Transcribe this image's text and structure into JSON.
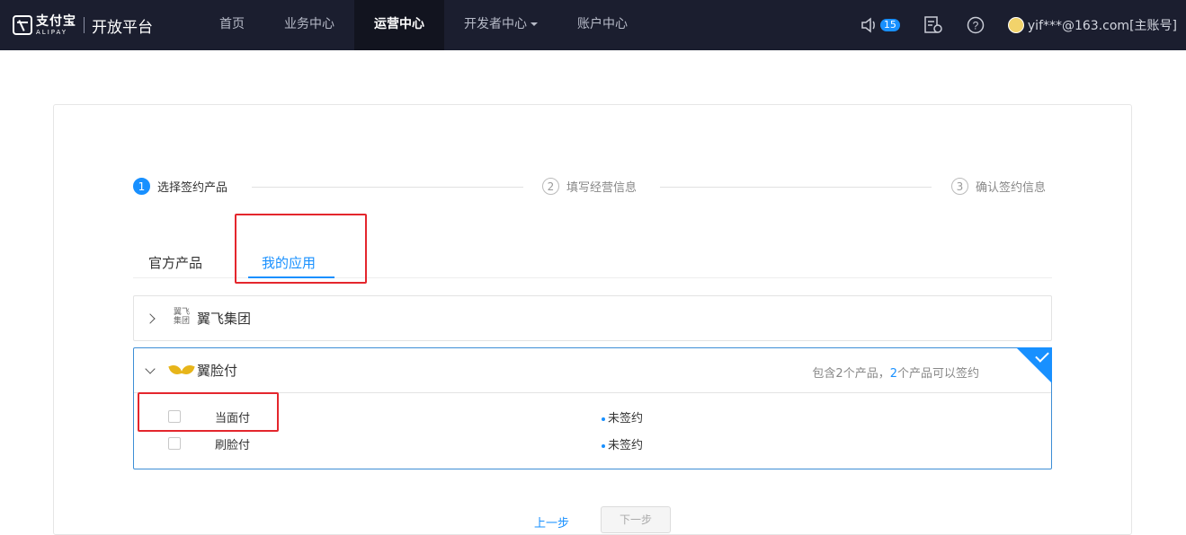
{
  "topbar": {
    "logo_cn": "支付宝",
    "logo_en": "ALIPAY",
    "platform": "开放平台",
    "nav": [
      "首页",
      "业务中心",
      "运营中心",
      "开发者中心",
      "账户中心"
    ],
    "active_nav": "运营中心",
    "notification_count": "15",
    "user": "yif***@163.com[主账号]"
  },
  "steps": [
    {
      "num": "1",
      "label": "选择签约产品"
    },
    {
      "num": "2",
      "label": "填写经营信息"
    },
    {
      "num": "3",
      "label": "确认签约信息"
    }
  ],
  "tabs": {
    "official": "官方产品",
    "mine": "我的应用"
  },
  "groups": [
    {
      "logo_text": "翼飞 集团",
      "name": "翼飞集团"
    },
    {
      "name": "翼脸付",
      "summary_prefix": "包含2个产品，",
      "summary_highlight": "2",
      "summary_suffix": "个产品可以签约",
      "products": [
        {
          "name": "当面付",
          "status": "未签约"
        },
        {
          "name": "刷脸付",
          "status": "未签约"
        }
      ]
    }
  ],
  "buttons": {
    "prev": "上一步",
    "next": "下一步"
  },
  "colors": {
    "accent": "#1890ff",
    "topbar": "#1b1e2f",
    "highlight_box": "#e4262d"
  }
}
